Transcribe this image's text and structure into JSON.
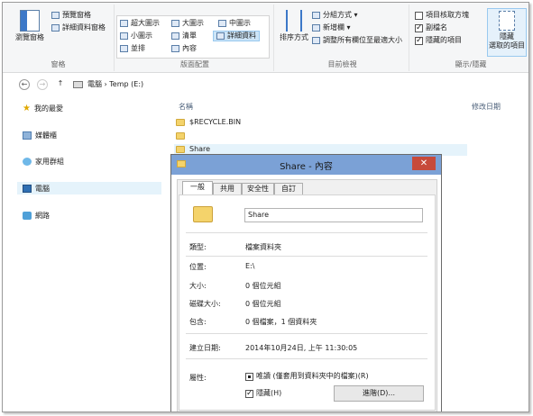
{
  "ribbon": {
    "pane_group": {
      "title": "窗格",
      "nav_pane_label": "瀏覽窗格",
      "preview_label": "預覽窗格",
      "details_label": "詳細資料窗格"
    },
    "layout_group": {
      "title": "版面配置",
      "items": [
        "超大圖示",
        "大圖示",
        "中圖示",
        "小圖示",
        "清單",
        "詳細資料",
        "並排",
        "內容"
      ],
      "selected": "詳細資料"
    },
    "view_group": {
      "title": "目前檢視",
      "sort_label": "排序方式",
      "group_by_label": "分組方式 ▾",
      "add_column_label": "新增欄 ▾",
      "fit_columns_label": "調整所有欄位至最適大小"
    },
    "showhide_group": {
      "title": "顯示/隱藏",
      "item_checkbox_label": "項目核取方塊",
      "extensions_label": "副檔名",
      "hidden_items_label": "隱藏的項目",
      "hide_selected_label_1": "隱藏",
      "hide_selected_label_2": "選取的項目"
    }
  },
  "address": {
    "back_icon": "←",
    "forward_icon": "→",
    "up_icon": "↑",
    "path": "電腦 › Temp (E:)"
  },
  "nav": {
    "favorites": "我的最愛",
    "libraries": "媒體櫃",
    "homegroup": "家用群組",
    "computer": "電腦",
    "network": "網路"
  },
  "content": {
    "col_name": "名稱",
    "col_modified": "修改日期",
    "rows": [
      "$RECYCLE.BIN",
      "",
      "Share"
    ]
  },
  "dialog": {
    "title": "Share - 內容",
    "close": "✕",
    "tabs": [
      "一般",
      "共用",
      "安全性",
      "自訂"
    ],
    "name_value": "Share",
    "type_label": "類型:",
    "type_value": "檔案資料夾",
    "location_label": "位置:",
    "location_value": "E:\\",
    "size_label": "大小:",
    "size_value": "0 個位元組",
    "disk_size_label": "磁碟大小:",
    "disk_size_value": "0 個位元組",
    "contains_label": "包含:",
    "contains_value": "0 個檔案，1 個資料夾",
    "created_label": "建立日期:",
    "created_value": "2014年10月24日, 上午 11:30:05",
    "attributes_label": "屬性:",
    "readonly_label": "唯讀 (僅套用到資料夾中的檔案)(R)",
    "hidden_label": "隱藏(H)",
    "advanced_button": "進階(D)..."
  }
}
